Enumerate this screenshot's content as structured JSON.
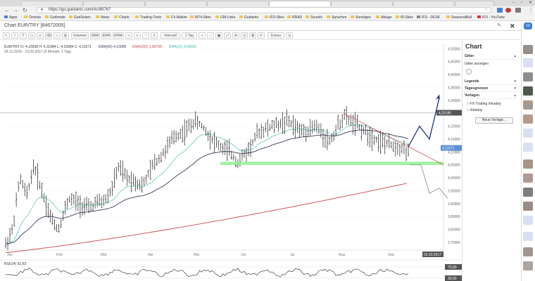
{
  "browser": {
    "tabs": [
      "",
      "",
      "",
      "",
      "",
      "",
      "",
      ""
    ],
    "url": "https://go.guidants.com/#c/89767",
    "bookmarks": [
      "Apps",
      "Onvista",
      "Godmode",
      "GodSeiten",
      "News",
      "Charts",
      "Trading-Tools",
      "FX-Makler",
      "MT4-Sites",
      "GM-Links",
      "Guidants",
      "IFD-Sites",
      "RRAD",
      "Sounds",
      "Sprachen",
      "Sonstiges",
      "Ablage",
      "IR-Sites",
      "IFD - DESK",
      "SeasonalBull",
      "IFD - YouTube"
    ]
  },
  "chart_header": {
    "title": "Chart EUR/TRY [84672005]",
    "legend_line1": "EUR/TRY  O: 4,10938  H: 4,11084  L: 4,10584  C: 4,11571",
    "ema50": "EMA(50)  4,10068",
    "ema200": "EMA(200)  3,86708",
    "ema21": "EMA(21)  4,09022",
    "range": "26.12.2016 - 13.09.2017 (9 Monate, 1 Tag)"
  },
  "toolbar": {
    "buttons": [
      "Volumen",
      "SMA",
      "EMA",
      "WMA",
      "Intervall",
      "1 Tag",
      "Extras"
    ]
  },
  "panel": {
    "title": "Chart",
    "rows": [
      "Gitter",
      "Gitter anzeigen",
      "Legende",
      "Tagesgrenzen",
      "Vorlagen"
    ],
    "option1": "FX-Trading Intraday",
    "option2": "Intraday",
    "button": "Neue Vorlage..."
  },
  "chart_data": {
    "type": "line",
    "title": "Chart EUR/TRY [84672005]",
    "x_labels": [
      "Jan",
      "Feb",
      "Mär",
      "Apr",
      "Mai",
      "Jun",
      "Jul",
      "Aug",
      "Sep"
    ],
    "y_ticks": [
      "4,50000",
      "4,45000",
      "4,40000",
      "4,35000",
      "4,30000",
      "4,25000",
      "4,20000",
      "4,15000",
      "4,10000",
      "4,05000",
      "4,00000",
      "3,95000",
      "3,90000",
      "3,85000",
      "3,80000",
      "3,75000"
    ],
    "ylim": [
      3.72,
      4.52
    ],
    "marker_price": "4,25195",
    "last_price": "4,11571",
    "date_label": "03.10.2017",
    "rsi": {
      "label": "RSI(14)",
      "value": "52,63",
      "ticks": [
        "70,00",
        "30,00"
      ]
    }
  }
}
